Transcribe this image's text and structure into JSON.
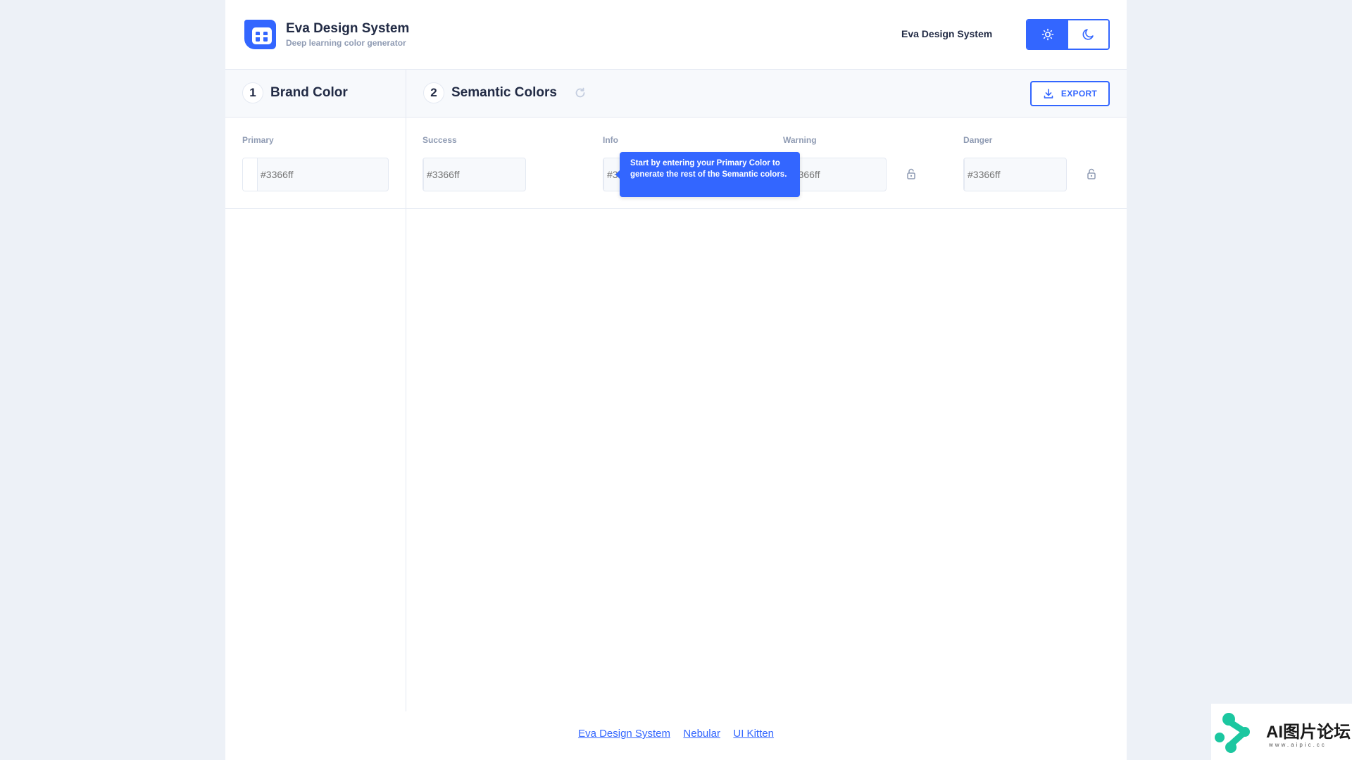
{
  "header": {
    "brand_title": "Eva Design System",
    "brand_subtitle": "Deep learning color generator",
    "nav_link": "Eva Design System",
    "theme": {
      "light_icon": "sun-icon",
      "dark_icon": "moon-icon",
      "active": "light"
    }
  },
  "sections": {
    "brand": {
      "number": "1",
      "title": "Brand Color"
    },
    "semantic": {
      "number": "2",
      "title": "Semantic Colors",
      "refresh_icon": "refresh-icon"
    },
    "export_label": "EXPORT"
  },
  "colors": {
    "primary": {
      "label": "Primary",
      "placeholder": "#3366ff"
    },
    "success": {
      "label": "Success",
      "placeholder": "#3366ff"
    },
    "info": {
      "label": "Info",
      "placeholder": "#3366ff"
    },
    "warning": {
      "label": "Warning",
      "placeholder": "#3366ff"
    },
    "danger": {
      "label": "Danger",
      "placeholder": "#3366ff"
    }
  },
  "tooltip": {
    "text": "Start by entering your Primary Color to generate the rest of the Semantic colors."
  },
  "footer": {
    "links": [
      "Eva Design System",
      "Nebular",
      "UI Kitten"
    ]
  },
  "watermark": {
    "title": "AI图片论坛",
    "url": "www.aipic.cc"
  },
  "palette": {
    "accent": "#3366ff",
    "text": "#222b45",
    "hint": "#8f9bb3",
    "border": "#e4e9f2"
  }
}
